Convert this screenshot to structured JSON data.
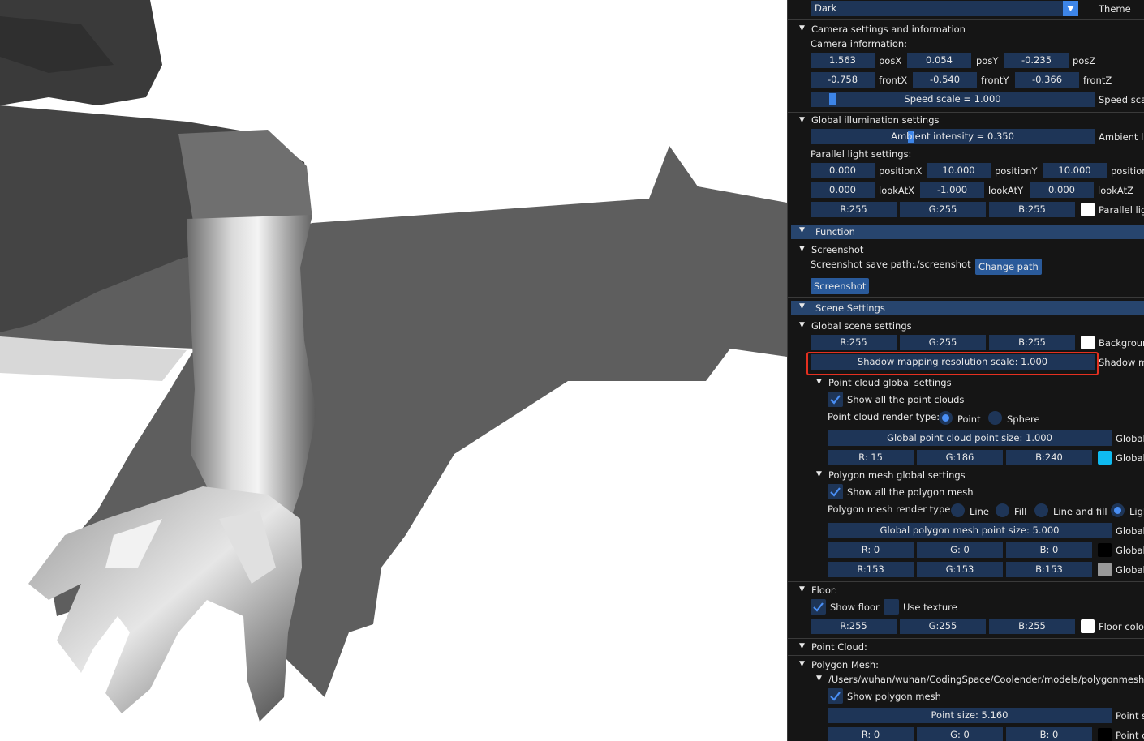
{
  "theme": {
    "value": "Dark",
    "label": "Theme"
  },
  "camera": {
    "header": "Camera settings and information",
    "info_label": "Camera information:",
    "posX": "1.563",
    "posX_label": "posX",
    "posY": "0.054",
    "posY_label": "posY",
    "posZ": "-0.235",
    "posZ_label": "posZ",
    "frontX": "-0.758",
    "frontX_label": "frontX",
    "frontY": "-0.540",
    "frontY_label": "frontY",
    "frontZ": "-0.366",
    "frontZ_label": "frontZ",
    "speed": "Speed scale = 1.000",
    "speed_label": "Speed sca",
    "speed_level": 0.066
  },
  "illumination": {
    "header": "Global illumination settings",
    "ambient": "Ambient intensity = 0.350",
    "ambient_label": "Ambient li",
    "ambient_level": 0.35,
    "parallel_label": "Parallel light settings:",
    "positionX": "0.000",
    "positionX_label": "positionX",
    "positionY": "10.000",
    "positionY_label": "positionY",
    "positionZ": "10.000",
    "positionZ_label": "position",
    "lookAtX": "0.000",
    "lookAtX_label": "lookAtX",
    "lookAtY": "-1.000",
    "lookAtY_label": "lookAtY",
    "lookAtZ": "0.000",
    "lookAtZ_label": "lookAtZ",
    "r": "R:255",
    "g": "G:255",
    "b": "B:255",
    "color_label": "Parallel lig",
    "color": "#ffffff"
  },
  "function": {
    "header": "Function",
    "screenshot_header": "Screenshot",
    "save_path_label": "Screenshot save path:",
    "save_path": "./screenshot",
    "change_path": "Change path",
    "screenshot_button": "Screenshot"
  },
  "scene": {
    "header": "Scene Settings",
    "global_header": "Global scene settings",
    "bg_r": "R:255",
    "bg_g": "G:255",
    "bg_b": "B:255",
    "bg_label": "Backgroun",
    "bg_color": "#ffffff",
    "shadow": "Shadow mapping resolution scale: 1.000",
    "shadow_label": "Shadow m",
    "pc_header": "Point cloud global settings",
    "pc_show": "Show all the point clouds",
    "pc_render_label": "Point cloud render type:",
    "pc_point": "Point",
    "pc_sphere": "Sphere",
    "pc_size": "Global point cloud point size: 1.000",
    "pc_size_label": "Global",
    "pc_r": "R: 15",
    "pc_g": "G:186",
    "pc_b": "B:240",
    "pc_color_label": "Global",
    "pc_color": "#0fbaf0",
    "pm_header": "Polygon mesh global settings",
    "pm_show": "Show all the polygon mesh",
    "pm_render_label": "Polygon mesh render type:",
    "pm_line": "Line",
    "pm_fill": "Fill",
    "pm_linefill": "Line and fill",
    "pm_light": "Ligl",
    "pm_size": "Global polygon mesh point size: 5.000",
    "pm_size_label": "Global",
    "pm_r1": "R:  0",
    "pm_g1": "G:  0",
    "pm_b1": "B:  0",
    "pm_color1_label": "Global",
    "pm_color1": "#000000",
    "pm_r2": "R:153",
    "pm_g2": "G:153",
    "pm_b2": "B:153",
    "pm_color2_label": "Global",
    "pm_color2": "#999999",
    "floor_header": "Floor:",
    "show_floor": "Show floor",
    "use_texture": "Use texture",
    "fl_r": "R:255",
    "fl_g": "G:255",
    "fl_b": "B:255",
    "floor_color_label": "Floor color",
    "floor_color": "#ffffff",
    "point_cloud_header": "Point Cloud:",
    "polygon_mesh_header": "Polygon Mesh:",
    "mesh_path": "/Users/wuhan/wuhan/CodingSpace/Coolender/models/polygonmesh/dia",
    "show_polygon_mesh": "Show polygon mesh",
    "mesh_point_size": "Point size: 5.160",
    "mesh_point_size_label": "Point s",
    "mesh_r": "R:  0",
    "mesh_g": "G:  0",
    "mesh_b": "B:  0",
    "mesh_color_label": "Point c",
    "mesh_color": "#000000"
  }
}
